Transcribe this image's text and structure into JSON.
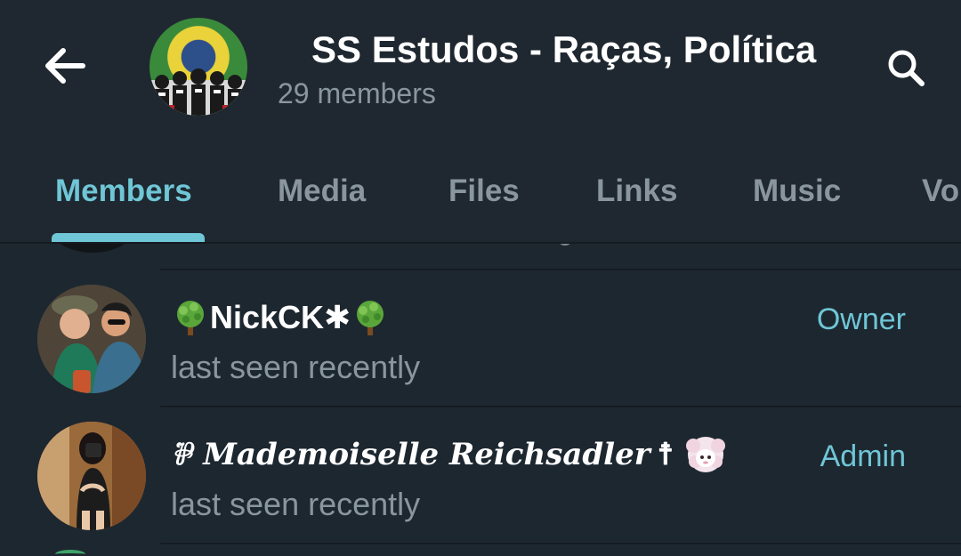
{
  "header": {
    "title": "SS Estudos - Raças, Política",
    "subtitle": "29 members",
    "back_icon": "arrow-left-icon",
    "search_icon": "search-icon"
  },
  "tabs": [
    {
      "label": "Members",
      "active": true
    },
    {
      "label": "Media",
      "active": false
    },
    {
      "label": "Files",
      "active": false
    },
    {
      "label": "Links",
      "active": false
    },
    {
      "label": "Music",
      "active": false
    },
    {
      "label": "Vo",
      "active": false
    }
  ],
  "members": [
    {
      "name_text": "NickCK",
      "name_prefix_icon": "tree-emoji-icon",
      "name_star": "✱",
      "name_suffix_icon": "tree-emoji-icon",
      "status": "last seen recently",
      "role": "Owner"
    },
    {
      "name_prefix": "⅌",
      "name_text": "Mademoiselle Reichsadler",
      "name_suffix": "☨",
      "name_suffix_icon": "sheep-emoji-icon",
      "status": "last seen recently",
      "role": "Admin"
    }
  ],
  "colors": {
    "background": "#1d2730",
    "accent": "#6fc6d6",
    "text_primary": "#ffffff",
    "text_secondary": "#8a969e"
  }
}
